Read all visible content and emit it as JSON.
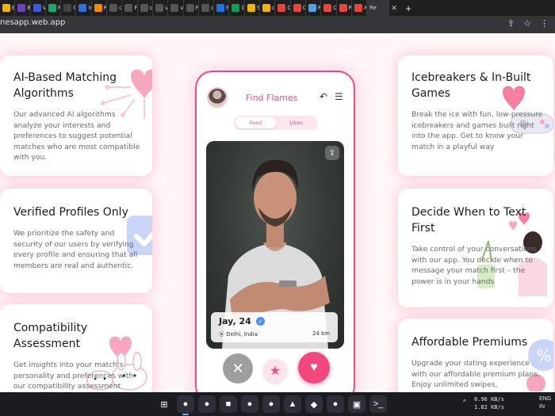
{
  "browser": {
    "tabs": [
      {
        "label": "B",
        "color": "#f4b400"
      },
      {
        "label": "B",
        "color": "#6f42c1"
      },
      {
        "label": "V",
        "color": "#3b5bdb"
      },
      {
        "label": "N",
        "color": "#19a974"
      },
      {
        "label": "G",
        "color": "#444444"
      },
      {
        "label": "Ir",
        "color": "#2f6fde"
      },
      {
        "label": "R",
        "color": "#f28b00"
      },
      {
        "label": "c",
        "color": "#555555"
      },
      {
        "label": "F",
        "color": "#555555"
      },
      {
        "label": "c",
        "color": "#555555"
      },
      {
        "label": "v",
        "color": "#555555"
      },
      {
        "label": "v",
        "color": "#555555"
      },
      {
        "label": "F",
        "color": "#555555"
      },
      {
        "label": "c",
        "color": "#555555"
      },
      {
        "label": "P",
        "color": "#1a73e8"
      },
      {
        "label": "G",
        "color": "#0f9d58"
      },
      {
        "label": "S",
        "color": "#f4b400"
      },
      {
        "label": "d",
        "color": "#f4b400"
      },
      {
        "label": "C",
        "color": "#e8453c"
      },
      {
        "label": "C",
        "color": "#e8453c"
      },
      {
        "label": "R",
        "color": "#4fa3e0"
      },
      {
        "label": "C",
        "color": "#e8453c"
      },
      {
        "label": "R",
        "color": "#e8453c"
      },
      {
        "label": "X",
        "color": "#ea4335"
      }
    ],
    "active_tab": {
      "label": "Re"
    },
    "url": "nesapp.web.app"
  },
  "cards": {
    "ai": {
      "title": "AI-Based Matching Algorithms",
      "text": "Our advanced AI algorithms analyze your interests and preferences to suggest potential matches who are most compatible with you."
    },
    "verified": {
      "title": "Verified Profiles Only",
      "text": "We prioritize the safety and security of our users by verifying every profile and ensuring that all members are real and authentic."
    },
    "compat": {
      "title": "Compatibility Assessment",
      "text": "Get insights into your match's personality and preferences with our compatibility assessment"
    },
    "ice": {
      "title": "Icebreakers & In-Built Games",
      "text": "Break the ice with fun, low-pressure icebreakers and games built right into the app. Get to know your match in a playful way"
    },
    "decide": {
      "title": "Decide When to Text First",
      "text": "Take control of your conversations with our app. You decide when to message your match first – the power is in your hands"
    },
    "premium": {
      "title": "Affordable Premiums",
      "text": "Upgrade your dating experience with our affordable premium plans. Enjoy unlimited swipes,"
    }
  },
  "phone": {
    "title": "Find Flames",
    "seg_feed": "Feed",
    "seg_likes": "Likes",
    "profile": {
      "name_age": "Jay, 24",
      "location": "Delhi, India",
      "distance": "24 km"
    }
  },
  "taskbar": {
    "net_up": "0.96 KB/s",
    "net_down": "1.82 KB/s",
    "lang1": "ENG",
    "lang2": "IN",
    "apps": [
      {
        "name": "start",
        "glyph": "⊞",
        "color": "#1b1c22"
      },
      {
        "name": "chrome",
        "glyph": "●",
        "color": "#2d3038"
      },
      {
        "name": "chrome-alt",
        "glyph": "●",
        "color": "#2d3038"
      },
      {
        "name": "files",
        "glyph": "■",
        "color": "#2d3038"
      },
      {
        "name": "whatsapp",
        "glyph": "●",
        "color": "#2d3038"
      },
      {
        "name": "app-red",
        "glyph": "●",
        "color": "#2d3038"
      },
      {
        "name": "app-blue",
        "glyph": "▲",
        "color": "#2d3038"
      },
      {
        "name": "vscode",
        "glyph": "◆",
        "color": "#2d3038"
      },
      {
        "name": "app-green",
        "glyph": "●",
        "color": "#2d3038"
      },
      {
        "name": "app-dark",
        "glyph": "▣",
        "color": "#2d3038"
      },
      {
        "name": "terminal",
        "glyph": ">_",
        "color": "#2d3038"
      }
    ]
  },
  "colors": {
    "accent": "#f0487f",
    "accent_light": "#fde6ee"
  }
}
